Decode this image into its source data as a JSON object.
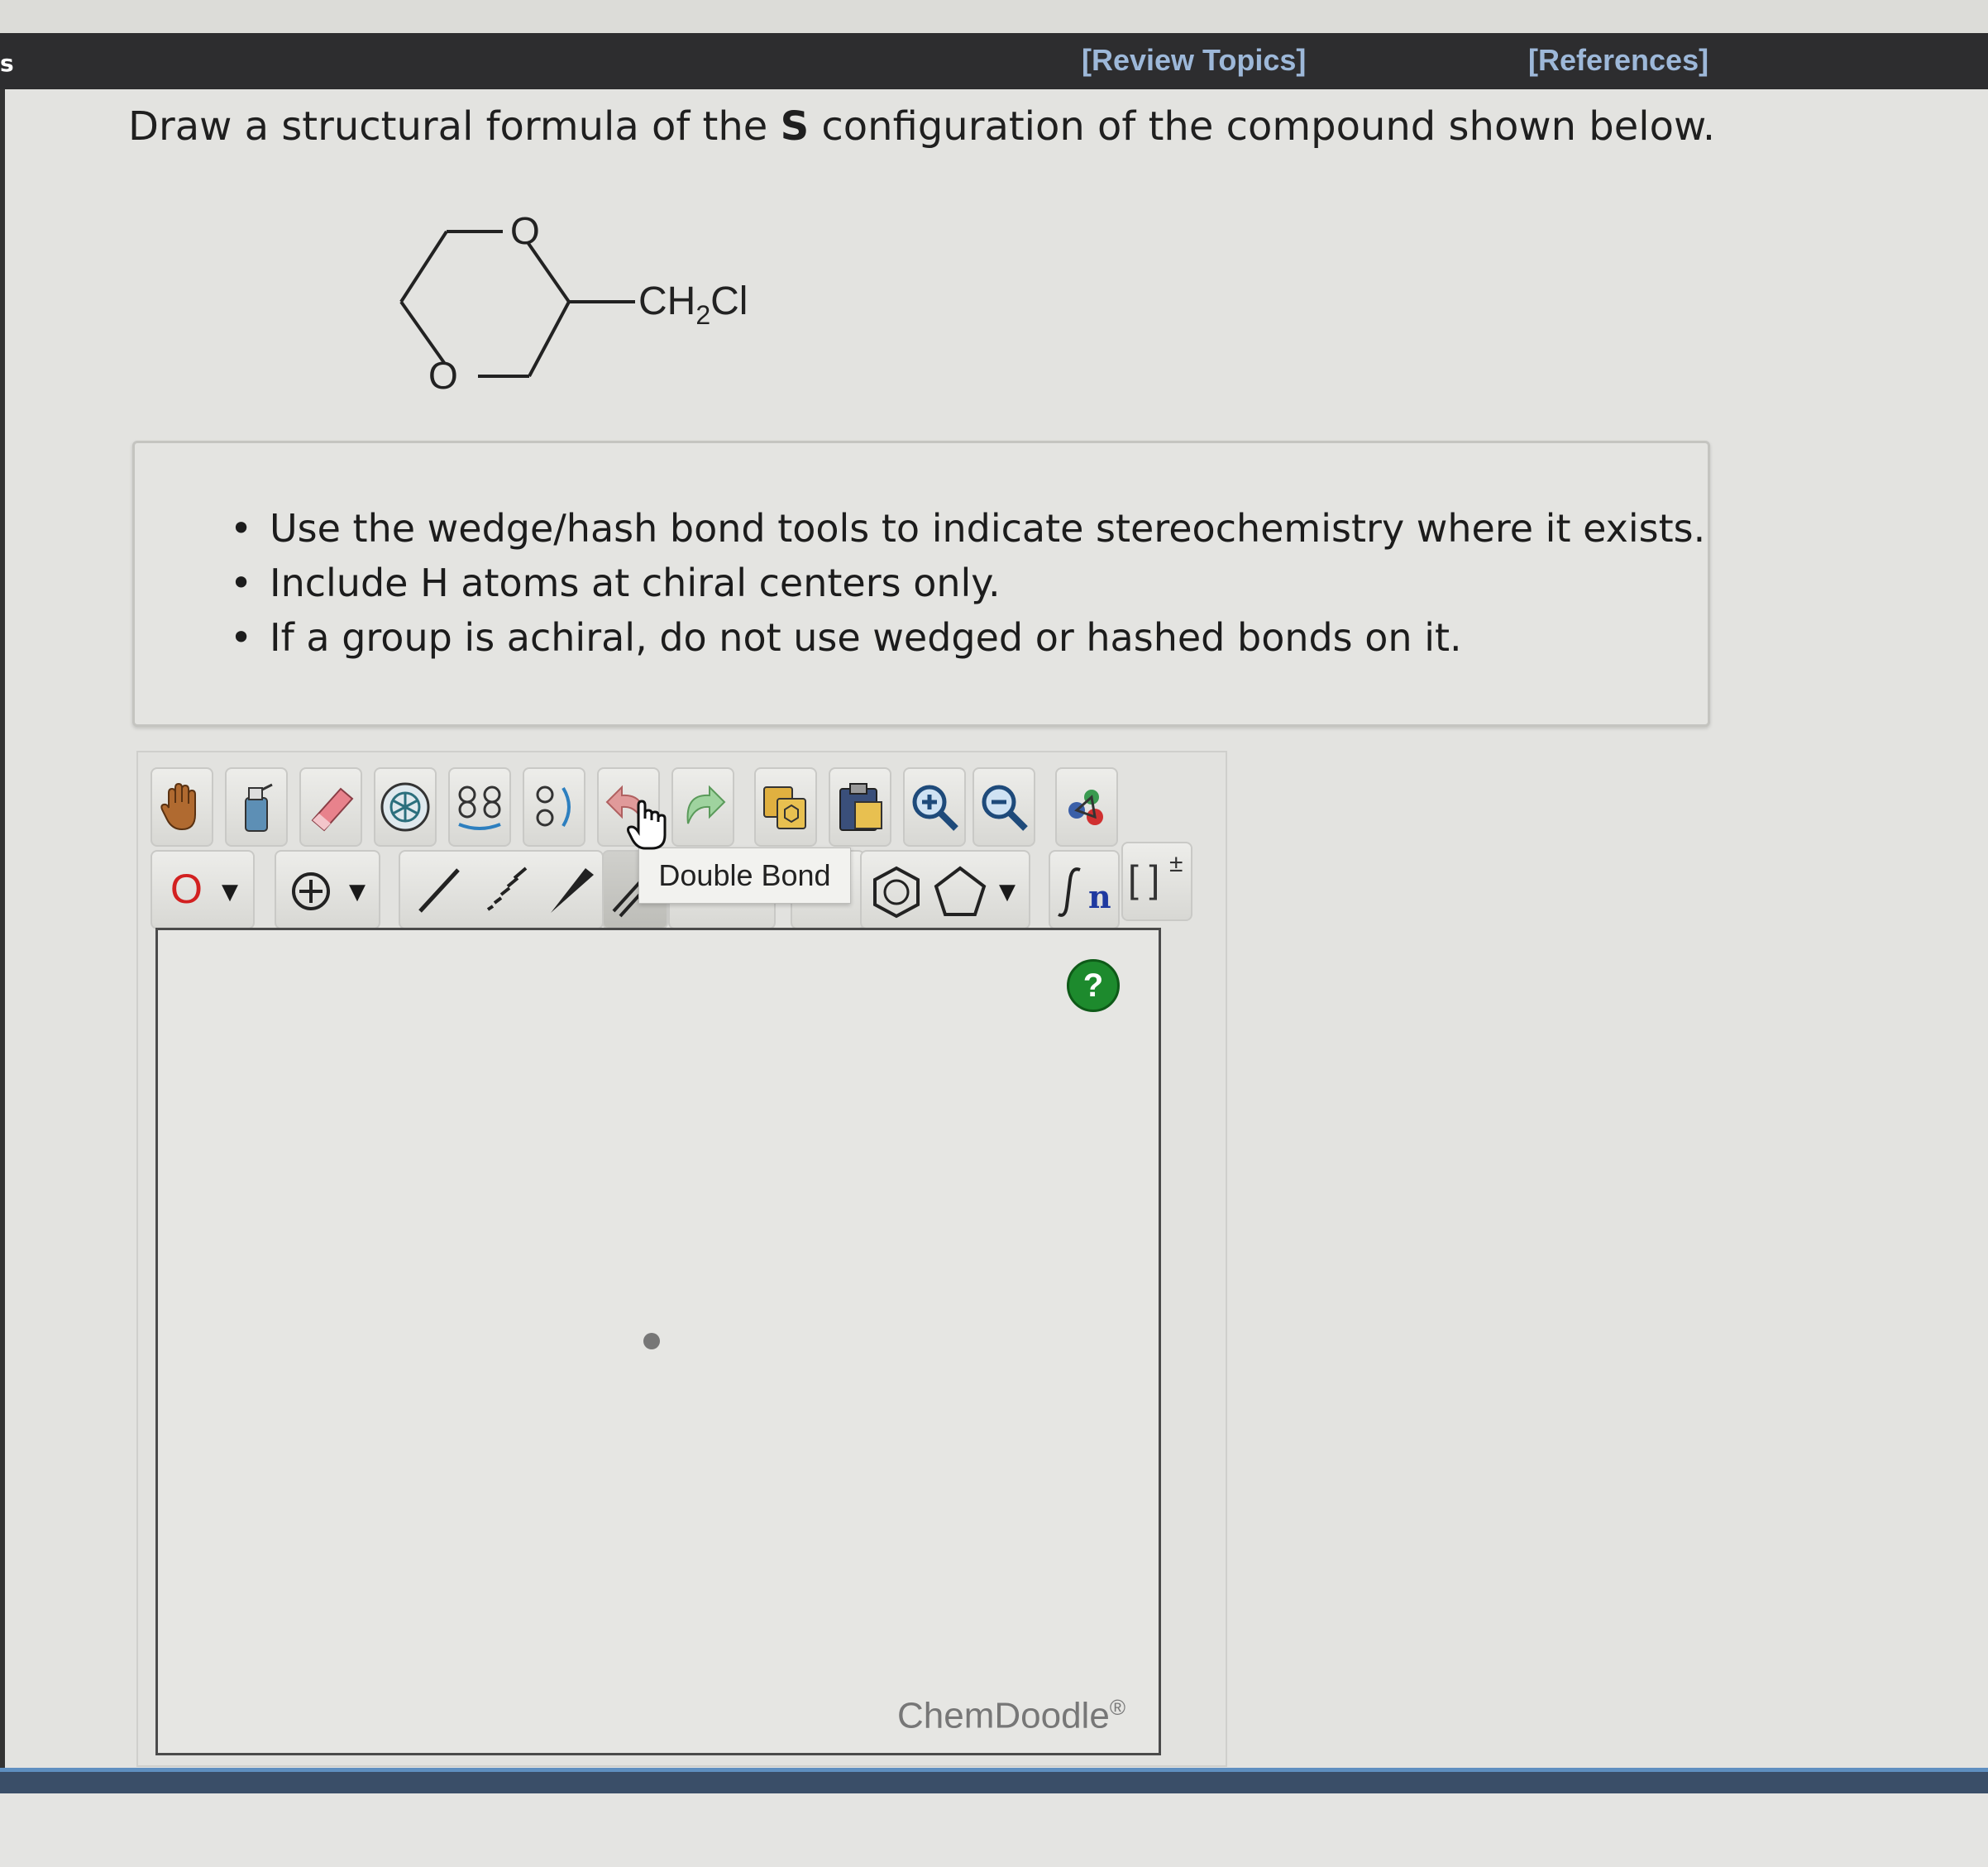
{
  "header": {
    "left_fragment": "s",
    "review_topics": "[Review Topics]",
    "references": "[References]"
  },
  "question": {
    "prefix": "Draw a structural formula of the ",
    "config": "S",
    "suffix": " configuration of the compound shown below."
  },
  "molecule": {
    "ring_o_top": "O",
    "ring_o_bottom": "O",
    "substituent_main": "CH",
    "substituent_sub": "2",
    "substituent_end": "Cl"
  },
  "instructions": [
    "Use the wedge/hash bond tools to indicate stereochemistry where it exists.",
    "Include H atoms at chiral centers only.",
    "If a group is achiral, do not use wedged or hashed bonds on it."
  ],
  "toolbar": {
    "atom_label": "O",
    "tooltip": "Double Bond",
    "sgroup_label": "n",
    "bracket_label": "[ ]",
    "bracket_charge": "±"
  },
  "canvas": {
    "help_label": "?",
    "brand": "ChemDoodle",
    "brand_mark": "®"
  },
  "colors": {
    "topbar": "#2d2d2f",
    "link": "#9db8d9",
    "help_green": "#1d8a2d",
    "atom_red": "#d22020"
  }
}
